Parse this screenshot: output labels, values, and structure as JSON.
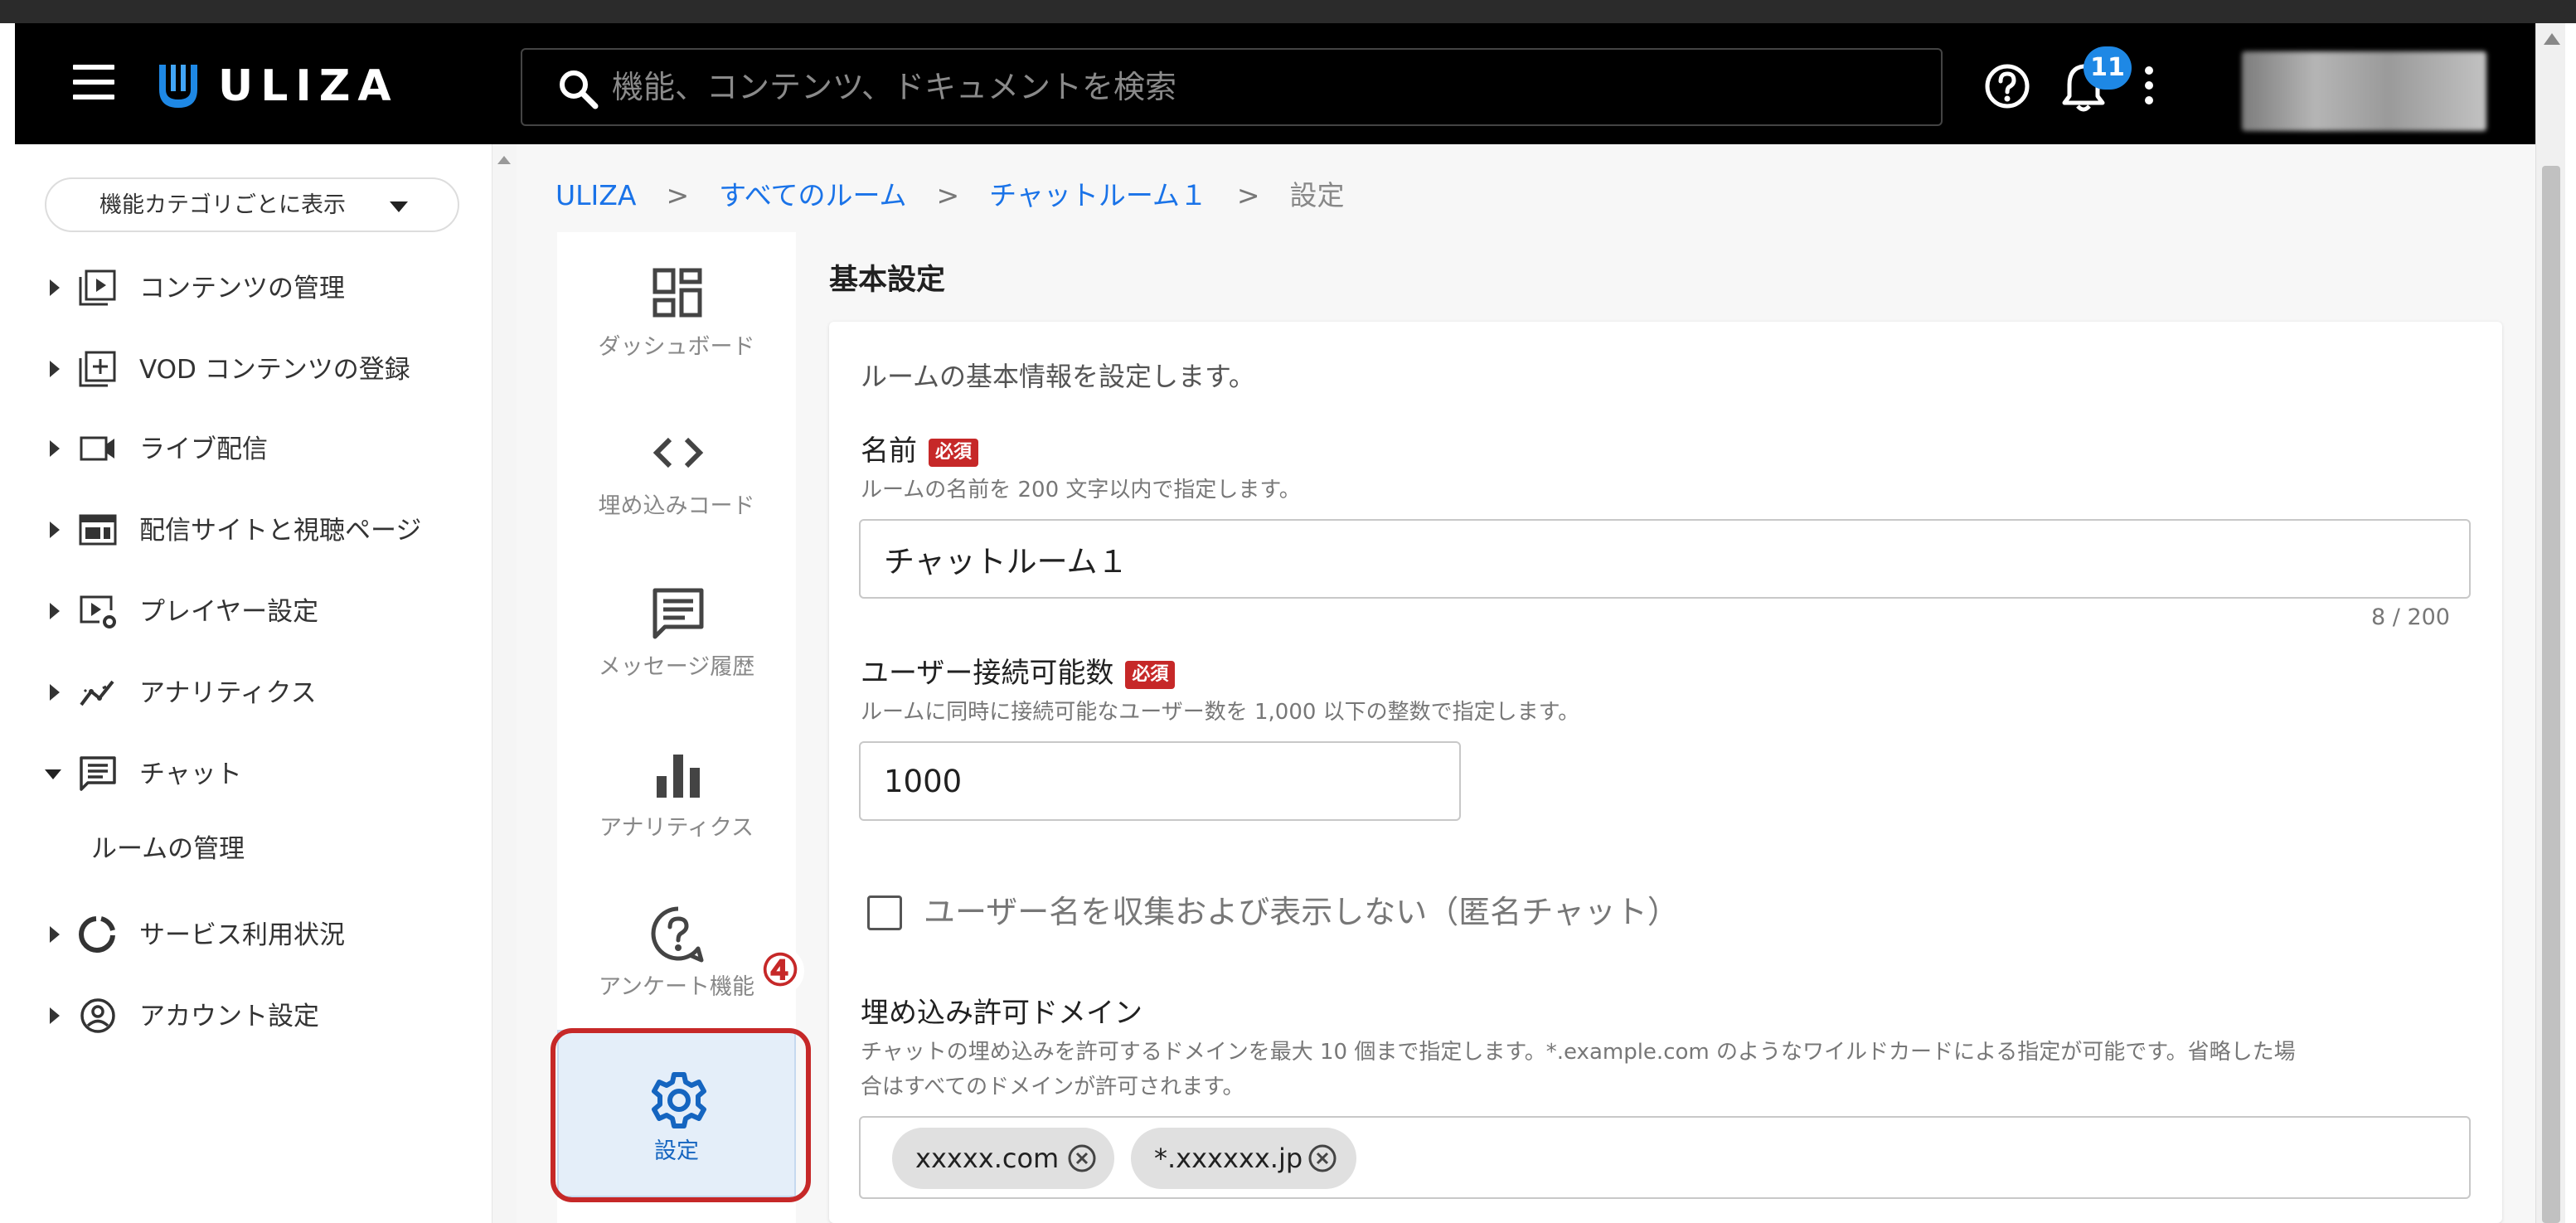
{
  "header": {
    "logo_text": "ULIZA",
    "search_placeholder": "機能、コンテンツ、ドキュメントを検索",
    "notification_count": "11"
  },
  "sidebar": {
    "category_button_label": "機能カテゴリごとに表示",
    "items": [
      {
        "label": "コンテンツの管理",
        "icon": "content-play-icon"
      },
      {
        "label": "VOD コンテンツの登録",
        "icon": "add-box-icon"
      },
      {
        "label": "ライブ配信",
        "icon": "video-camera-icon"
      },
      {
        "label": "配信サイトと視聴ページ",
        "icon": "web-page-icon"
      },
      {
        "label": "プレイヤー設定",
        "icon": "player-settings-icon"
      },
      {
        "label": "アナリティクス",
        "icon": "analytics-icon"
      },
      {
        "label": "チャット",
        "icon": "chat-icon"
      },
      {
        "label": "サービス利用状況",
        "icon": "usage-donut-icon"
      },
      {
        "label": "アカウント設定",
        "icon": "account-circle-icon"
      }
    ],
    "chat_subitem": "ルームの管理"
  },
  "breadcrumb": {
    "items": [
      "ULIZA",
      "すべてのルーム",
      "チャットルーム１"
    ],
    "current": "設定",
    "separator": ">"
  },
  "subnav": {
    "items": [
      {
        "label": "ダッシュボード",
        "icon": "dashboard-icon"
      },
      {
        "label": "埋め込みコード",
        "icon": "code-icon"
      },
      {
        "label": "メッセージ履歴",
        "icon": "message-history-icon"
      },
      {
        "label": "アナリティクス",
        "icon": "bar-chart-icon"
      },
      {
        "label": "アンケート機能",
        "icon": "survey-question-icon"
      },
      {
        "label": "設定",
        "icon": "gear-icon"
      }
    ],
    "active": "設定",
    "callout_number": "④"
  },
  "settings": {
    "section_title": "基本設定",
    "description": "ルームの基本情報を設定します。",
    "required_label": "必須",
    "name_field": {
      "label": "名前",
      "hint": "ルームの名前を 200 文字以内で指定します。",
      "value": "チャットルーム１",
      "counter": "8 / 200"
    },
    "max_users_field": {
      "label": "ユーザー接続可能数",
      "hint": "ルームに同時に接続可能なユーザー数を 1,000 以下の整数で指定します。",
      "value": "1000"
    },
    "anonymous_checkbox": {
      "label": "ユーザー名を収集および表示しない（匿名チャット）",
      "checked": false
    },
    "allowed_domains": {
      "label": "埋め込み許可ドメイン",
      "hint_line1": "チャットの埋め込みを許可するドメインを最大 10 個まで指定します。*.example.com のようなワイルドカードによる指定が可能です。省略した場",
      "hint_line2": "合はすべてのドメインが許可されます。",
      "chips": [
        "xxxxx.com",
        "*.xxxxxx.jp"
      ]
    }
  },
  "colors": {
    "topbar_bg": "#000000",
    "accent_blue": "#1a73e8",
    "required_red": "#c62828",
    "active_bg": "#e4eef9"
  }
}
